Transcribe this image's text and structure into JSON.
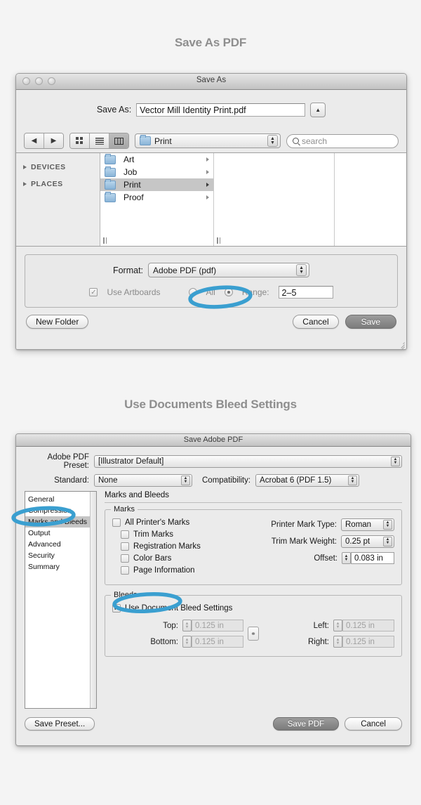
{
  "headings": {
    "save_as_pdf": "Save As PDF",
    "bleed": "Use Documents Bleed Settings"
  },
  "save_as_dialog": {
    "title": "Save As",
    "save_as_label": "Save As:",
    "filename": "Vector Mill Identity Print.pdf",
    "disclosure_icon": "▲",
    "toolbar": {
      "back_icon": "◀",
      "forward_icon": "▶",
      "view_icon_grid": "⁙",
      "view_icon_list": "≡",
      "view_icon_column": "█",
      "path_value": "Print",
      "search_placeholder": "search"
    },
    "sidebar": {
      "groups": [
        {
          "label": "DEVICES"
        },
        {
          "label": "PLACES"
        }
      ]
    },
    "folders": [
      {
        "name": "Art",
        "selected": false
      },
      {
        "name": "Job",
        "selected": false
      },
      {
        "name": "Print",
        "selected": true
      },
      {
        "name": "Proof",
        "selected": false
      }
    ],
    "format_label": "Format:",
    "format_value": "Adobe PDF (pdf)",
    "use_artboards_label": "Use Artboards",
    "use_artboards_checked": true,
    "all_label": "All",
    "range_label": "Range:",
    "range_selected": true,
    "range_value": "2–5",
    "buttons": {
      "new_folder": "New Folder",
      "cancel": "Cancel",
      "save": "Save"
    }
  },
  "pdf_dialog": {
    "title": "Save Adobe PDF",
    "preset_label": "Adobe PDF Preset:",
    "preset_value": "[Illustrator Default]",
    "standard_label": "Standard:",
    "standard_value": "None",
    "compatibility_label": "Compatibility:",
    "compatibility_value": "Acrobat 6 (PDF 1.5)",
    "categories": [
      {
        "label": "General",
        "selected": false
      },
      {
        "label": "Compression",
        "selected": false
      },
      {
        "label": "Marks and Bleeds",
        "selected": true
      },
      {
        "label": "Output",
        "selected": false
      },
      {
        "label": "Advanced",
        "selected": false
      },
      {
        "label": "Security",
        "selected": false
      },
      {
        "label": "Summary",
        "selected": false
      }
    ],
    "pane_title": "Marks and Bleeds",
    "marks": {
      "group_label": "Marks",
      "checkboxes": [
        {
          "label": "All Printer's Marks",
          "checked": false,
          "indent": false
        },
        {
          "label": "Trim Marks",
          "checked": false,
          "indent": true
        },
        {
          "label": "Registration Marks",
          "checked": false,
          "indent": true
        },
        {
          "label": "Color Bars",
          "checked": false,
          "indent": true
        },
        {
          "label": "Page Information",
          "checked": false,
          "indent": true
        }
      ],
      "printer_mark_type_label": "Printer Mark Type:",
      "printer_mark_type_value": "Roman",
      "trim_mark_weight_label": "Trim Mark Weight:",
      "trim_mark_weight_value": "0.25 pt",
      "offset_label": "Offset:",
      "offset_value": "0.083 in"
    },
    "bleeds": {
      "group_label": "Bleeds",
      "use_document_label": "Use Document Bleed Settings",
      "use_document_checked": true,
      "top_label": "Top:",
      "top_value": "0.125 in",
      "bottom_label": "Bottom:",
      "bottom_value": "0.125 in",
      "left_label": "Left:",
      "left_value": "0.125 in",
      "right_label": "Right:",
      "right_value": "0.125 in",
      "link_icon": "⚭"
    },
    "buttons": {
      "save_preset": "Save Preset...",
      "save_pdf": "Save PDF",
      "cancel": "Cancel"
    }
  },
  "annotations": {
    "color": "#3a9fd0",
    "items": [
      {
        "name": "range-highlight"
      },
      {
        "name": "marks-and-bleeds-highlight"
      },
      {
        "name": "use-document-bleed-highlight"
      }
    ]
  },
  "colors": {
    "page_background": "#f4f4f4",
    "heading": "#8e8e8e",
    "annotation_blue": "#3a9fd0"
  }
}
